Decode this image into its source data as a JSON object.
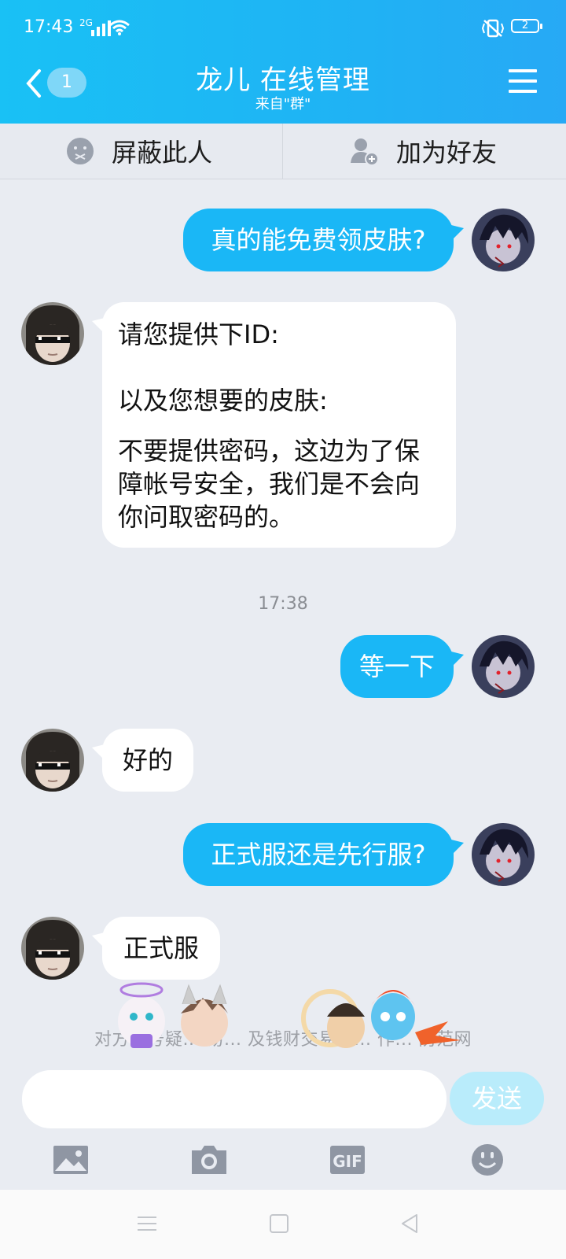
{
  "status": {
    "time": "17:43",
    "network": "2G",
    "battery": "2"
  },
  "header": {
    "unread_count": "1",
    "title": "龙儿 在线管理",
    "subtitle": "来自\"群\""
  },
  "actions": {
    "block_label": "屏蔽此人",
    "add_friend_label": "加为好友"
  },
  "messages": [
    {
      "side": "out",
      "text": "真的能免费领皮肤?"
    },
    {
      "side": "in",
      "text_lines": [
        "请您提供下ID:",
        "",
        "以及您想要的皮肤:",
        "",
        "不要提供密码，这边为了保",
        "障帐号安全，我们是不会向",
        "你问取密码的。"
      ]
    },
    {
      "side": "out",
      "text": "等一下"
    },
    {
      "side": "in",
      "text": "好的"
    },
    {
      "side": "out",
      "text": "正式服还是先行服?"
    },
    {
      "side": "in",
      "text": "正式服"
    }
  ],
  "timestamp": "17:38",
  "warning": "对方帐号疑... 易... 及钱财交易请... 作... 防范网",
  "input": {
    "placeholder": "",
    "send_label": "发送"
  },
  "toolbar_icons": [
    "image-icon",
    "camera-icon",
    "gif-icon",
    "emoji-icon"
  ],
  "toolbar": {
    "gif_label": "GIF"
  },
  "colors": {
    "header": "#1fb3f4",
    "bubble_out": "#1ab7f6",
    "bubble_in": "#ffffff",
    "background": "#e9ecf2"
  }
}
